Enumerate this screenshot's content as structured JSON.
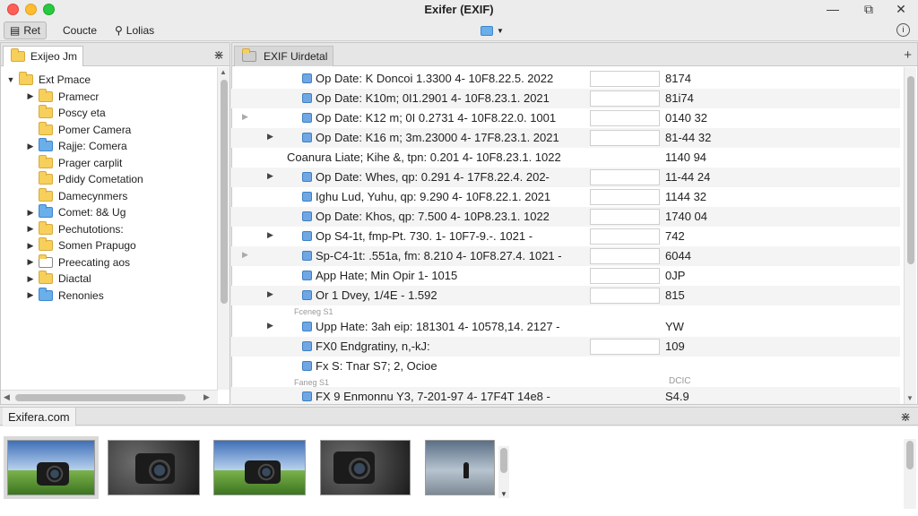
{
  "window": {
    "title": "Exifer (EXIF)"
  },
  "toolbar": {
    "items": [
      {
        "label": "Ret",
        "icon": "document-icon"
      },
      {
        "label": "Coucte",
        "icon": ""
      },
      {
        "label": "Lolias",
        "icon": "search-icon"
      }
    ]
  },
  "left_tab": {
    "label": "Exijeo Jm"
  },
  "right_tab": {
    "label": "EXIF Uirdetal"
  },
  "tree": {
    "root": "Ext Pmace",
    "items": [
      "Pramecr",
      "Poscy eta",
      "Pomer Camera",
      "Rajje: Comera",
      "Prager carplit",
      "Pdidy Cometation",
      "Damecynmers",
      "Comet: 8& Ug",
      "Pechutotions:",
      "Somen Prapugo",
      "Preecating aos",
      "Diactal",
      "Renonies"
    ]
  },
  "rows": [
    {
      "text": "Op Date: K Doncoi 1.3300 4- 10F8.22.5. 2022",
      "value": "8174"
    },
    {
      "text": "Op Date: K10m; 0I1.2901 4- 10F8.23.1. 2021",
      "value": "81i74"
    },
    {
      "text": "Op Date: K12 m; 0I 0.2731 4- 10F8.22.0. 1001",
      "value": "0140 32"
    },
    {
      "text": "Op Date: K16 m; 3m.23000 4- 17F8.23.1. 2021",
      "value": "81-44 32"
    },
    {
      "text": "Coanura Liate; Kihe &, tpn: 0.201 4- 10F8.23.1. 1022",
      "value": "1140 94"
    },
    {
      "text": "Op Date: Whes, qp: 0.291 4- 17F8.22.4. 202-",
      "value": "11-44 24"
    },
    {
      "text": "Ighu Lud, Yuhu, qp: 9.290 4- 10F8.22.1. 2021",
      "value": "1144 32"
    },
    {
      "text": "Op Date: Khos, qp: 7.500 4- 10P8.23.1. 1022",
      "value": "1740 04"
    },
    {
      "text": "Op S4-1t, fmp-Pt. 730.    1- 10F7-9.-. 1021 -",
      "value": "742"
    },
    {
      "text": "Sp-C4-1t: .551a, fm: 8.210 4- 10F8.27.4. 1021 -",
      "value": "6044"
    },
    {
      "text": "App Hate; Min Opir    1- 1015",
      "value": "0JP"
    },
    {
      "text": "Or 1 Dvey, 1/4E - 1.592",
      "value": "815"
    },
    {
      "text": "Upp Hate: 3ah eip: 181301 4- 10578,14. 2127 -",
      "value": "YW"
    },
    {
      "text": "FX0 Endgratiny, n,-kJ:",
      "value": "109"
    },
    {
      "text": "Fx S: Tnar S7; 2, Ocioe",
      "value": ""
    },
    {
      "text": "FX 9 Enmonnu Y3, 7-201-97 4- 17F4T    14e8 -",
      "value": "S4.9"
    }
  ],
  "subrows": [
    "Fceneg S1",
    "Faneg S1",
    "DCIC"
  ],
  "footer": {
    "label": "Exifera.com"
  },
  "thumbnails": [
    {
      "kind": "camera-on-grass",
      "selected": true
    },
    {
      "kind": "camera-dark",
      "selected": false
    },
    {
      "kind": "camera-on-grass",
      "selected": false
    },
    {
      "kind": "camera-dark",
      "selected": false
    },
    {
      "kind": "person-at-sea",
      "selected": false
    }
  ]
}
